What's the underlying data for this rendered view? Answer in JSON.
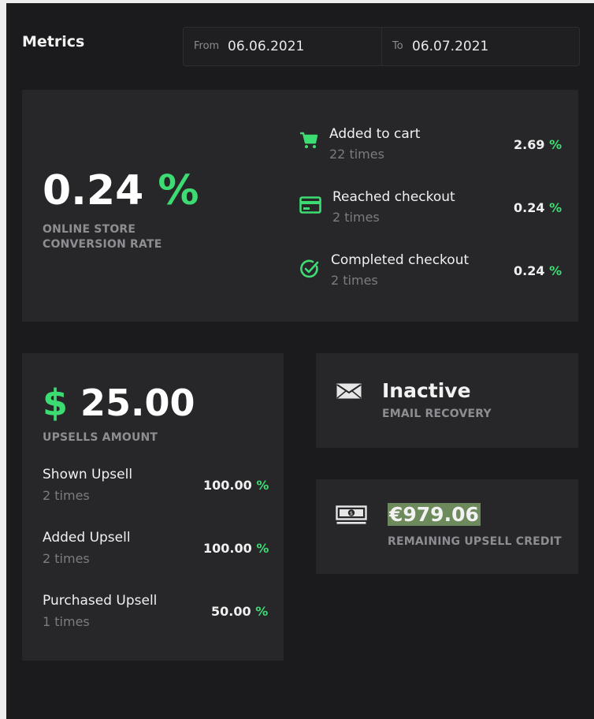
{
  "header": {
    "title": "Metrics",
    "from_label": "From",
    "from_value": "06.06.2021",
    "to_label": "To",
    "to_value": "06.07.2021"
  },
  "conversion": {
    "value": "0.24",
    "unit": "%",
    "label_line1": "ONLINE STORE",
    "label_line2": "CONVERSION RATE",
    "steps": [
      {
        "icon": "cart-icon",
        "title": "Added to cart",
        "sub": "22 times",
        "pct": "2.69",
        "unit": "%"
      },
      {
        "icon": "credit-card-icon",
        "title": "Reached checkout",
        "sub": "2 times",
        "pct": "0.24",
        "unit": "%"
      },
      {
        "icon": "check-circle-icon",
        "title": "Completed checkout",
        "sub": "2 times",
        "pct": "0.24",
        "unit": "%"
      }
    ]
  },
  "upsells": {
    "currency": "$",
    "amount": "25.00",
    "label": "UPSELLS AMOUNT",
    "rows": [
      {
        "title": "Shown Upsell",
        "sub": "2 times",
        "pct": "100.00",
        "unit": "%"
      },
      {
        "title": "Added Upsell",
        "sub": "2 times",
        "pct": "100.00",
        "unit": "%"
      },
      {
        "title": "Purchased Upsell",
        "sub": "1 times",
        "pct": "50.00",
        "unit": "%"
      }
    ]
  },
  "email_recovery": {
    "icon": "envelope-icon",
    "status": "Inactive",
    "label": "EMAIL RECOVERY"
  },
  "credit": {
    "icon": "banknote-icon",
    "value": "€979.06",
    "label": "REMAINING UPSELL CREDIT"
  },
  "colors": {
    "accent": "#3ddc73",
    "background": "#1b1b1e",
    "card": "#27272a"
  }
}
